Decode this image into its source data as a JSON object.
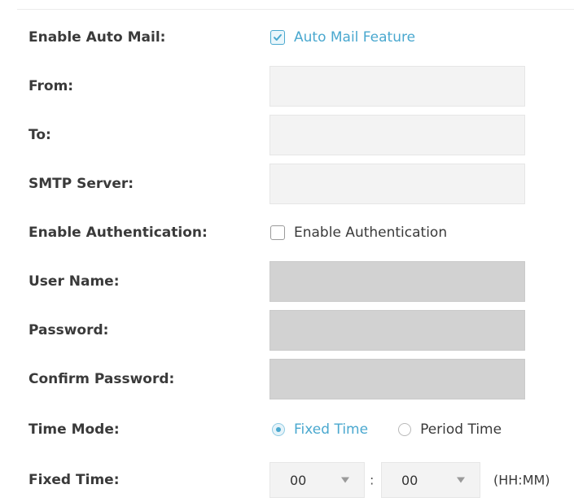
{
  "colors": {
    "accent": "#4aa8cf",
    "field_bg": "#f3f3f3",
    "field_disabled_bg": "#d2d2d2",
    "label_text": "#3a3a3a"
  },
  "form": {
    "auto_mail": {
      "label": "Enable Auto Mail:",
      "option_label": "Auto Mail Feature",
      "checked": true
    },
    "from": {
      "label": "From:",
      "value": ""
    },
    "to": {
      "label": "To:",
      "value": ""
    },
    "smtp_server": {
      "label": "SMTP Server:",
      "value": ""
    },
    "authentication": {
      "label": "Enable Authentication:",
      "option_label": "Enable Authentication",
      "checked": false
    },
    "user_name": {
      "label": "User Name:",
      "value": "",
      "disabled": true
    },
    "password": {
      "label": "Password:",
      "value": "",
      "disabled": true
    },
    "confirm_password": {
      "label": "Confirm Password:",
      "value": "",
      "disabled": true
    },
    "time_mode": {
      "label": "Time Mode:",
      "options": [
        "Fixed Time",
        "Period Time"
      ],
      "selected": "Fixed Time"
    },
    "fixed_time": {
      "label": "Fixed Time:",
      "hour": "00",
      "minute": "00",
      "separator": ":",
      "format_hint": "(HH:MM)",
      "dropdown_icon": "triangle-down-icon"
    }
  }
}
